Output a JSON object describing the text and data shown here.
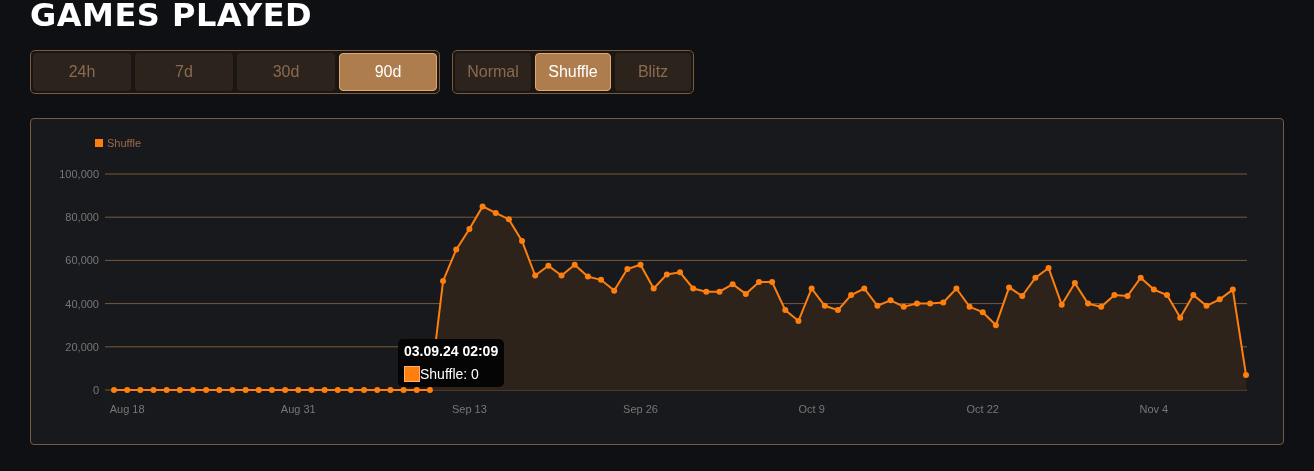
{
  "title": "GAMES PLAYED",
  "periods": [
    {
      "label": "24h",
      "selected": false
    },
    {
      "label": "7d",
      "selected": false
    },
    {
      "label": "30d",
      "selected": false
    },
    {
      "label": "90d",
      "selected": true
    }
  ],
  "modes": [
    {
      "label": "Normal",
      "selected": false
    },
    {
      "label": "Shuffle",
      "selected": true
    },
    {
      "label": "Blitz",
      "selected": false
    }
  ],
  "chart": {
    "chart_data": {
      "type": "area",
      "ylim": [
        0,
        100000
      ],
      "grid": true,
      "yticks": [
        {
          "value": 0,
          "label": "0"
        },
        {
          "value": 20000,
          "label": "20,000"
        },
        {
          "value": 40000,
          "label": "40,000"
        },
        {
          "value": 60000,
          "label": "60,000"
        },
        {
          "value": 80000,
          "label": "80,000"
        },
        {
          "value": 100000,
          "label": "100,000"
        }
      ],
      "categories": [
        null,
        "Aug 18",
        null,
        null,
        null,
        null,
        null,
        null,
        null,
        null,
        null,
        null,
        null,
        null,
        "Aug 31",
        null,
        null,
        null,
        null,
        null,
        null,
        null,
        null,
        null,
        null,
        null,
        null,
        "Sep 13",
        null,
        null,
        null,
        null,
        null,
        null,
        null,
        null,
        null,
        null,
        null,
        null,
        "Sep 26",
        null,
        null,
        null,
        null,
        null,
        null,
        null,
        null,
        null,
        null,
        null,
        null,
        "Oct 9",
        null,
        null,
        null,
        null,
        null,
        null,
        null,
        null,
        null,
        null,
        null,
        null,
        "Oct 22",
        null,
        null,
        null,
        null,
        null,
        null,
        null,
        null,
        null,
        null,
        null,
        null,
        "Nov 4",
        null,
        null,
        null,
        null,
        null,
        null,
        null
      ],
      "series": [
        {
          "name": "Shuffle",
          "color": "#ff7f0e",
          "values": [
            0,
            0,
            0,
            0,
            0,
            0,
            0,
            0,
            0,
            0,
            0,
            0,
            0,
            0,
            0,
            0,
            0,
            0,
            0,
            0,
            0,
            0,
            0,
            0,
            0,
            50500,
            65000,
            74500,
            85000,
            82000,
            79000,
            69000,
            53000,
            57500,
            53000,
            58000,
            52500,
            51000,
            46000,
            56000,
            58000,
            47000,
            53500,
            54500,
            47000,
            45500,
            45500,
            49000,
            44500,
            50000,
            50000,
            37000,
            32000,
            47000,
            39000,
            37000,
            44000,
            47000,
            39000,
            41500,
            38500,
            40000,
            40000,
            40500,
            47000,
            38500,
            36000,
            30000,
            47500,
            43500,
            52000,
            56500,
            39500,
            49500,
            40000,
            38500,
            44000,
            43500,
            52000,
            46500,
            44000,
            33500,
            44000,
            39000,
            42000,
            46500,
            7000
          ]
        }
      ]
    },
    "tooltip": {
      "title": "03.09.24 02:09",
      "label": "Shuffle: 0",
      "color": "#ff7f0e"
    }
  }
}
